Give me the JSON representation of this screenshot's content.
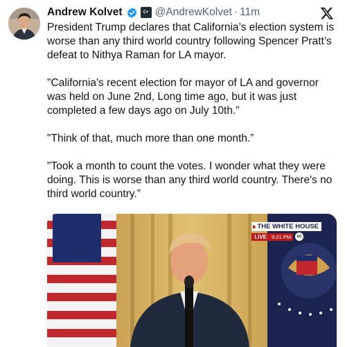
{
  "tweet": {
    "author_name": "Andrew Kolvet",
    "affiliate_badge": "C+",
    "handle": "@AndrewKolvet",
    "separator": "·",
    "time": "11m",
    "paragraphs": [
      "President Trump declares that California’s election system is worse than any third world country following Spencer Pratt’s defeat to Nithya Raman for LA mayor.",
      "\"California's recent election for mayor of LA and governor was held on June 2nd, Long time ago, but it was just completed a few days ago on July 10th.”",
      "\"Think of that, much more than one month.”",
      "\"Took a month to count the votes. I wonder what they were doing. This is worse than any third world country. There's no third world country.”"
    ]
  },
  "media": {
    "badge_title": "THE WHITE HOUSE",
    "badge_live": "LIVE",
    "badge_time": "9:21 PM",
    "badge_cc": "cc"
  },
  "icons": {
    "verified": "verified-check-icon",
    "platform": "x-logo-icon"
  },
  "colors": {
    "verified_blue": "#1d9bf0",
    "muted_text": "#536471",
    "live_red": "#c01a1a"
  }
}
